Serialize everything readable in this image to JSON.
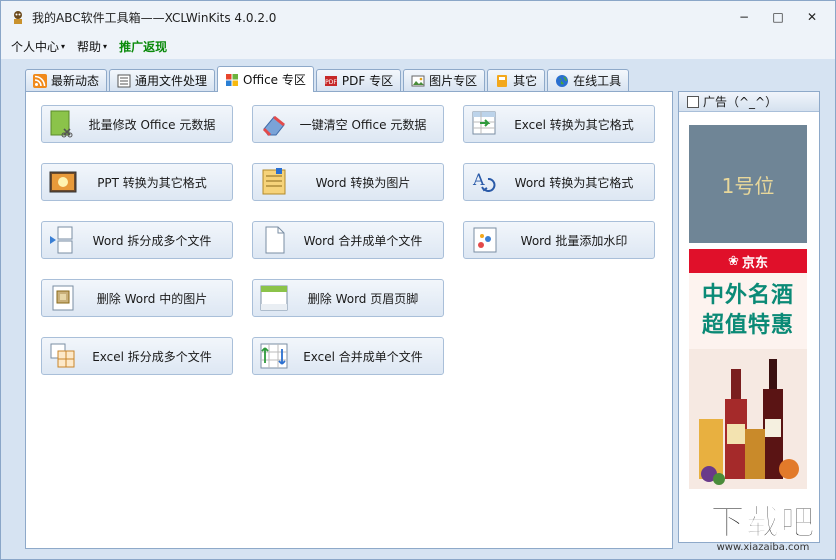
{
  "window": {
    "title": "我的ABC软件工具箱——XCLWinKits  4.0.2.0",
    "minimize": "−",
    "maximize": "□",
    "close": "✕"
  },
  "menu": {
    "items": [
      {
        "label": "个人中心",
        "has_caret": true
      },
      {
        "label": "帮助",
        "has_caret": true
      },
      {
        "label": "推广返现",
        "has_caret": false
      }
    ],
    "caret": "▾"
  },
  "tabs": [
    {
      "label": "最新动态",
      "icon": "rss-icon"
    },
    {
      "label": "通用文件处理",
      "icon": "file-icon"
    },
    {
      "label": "Office 专区",
      "icon": "office-icon",
      "active": true
    },
    {
      "label": "PDF 专区",
      "icon": "pdf-icon"
    },
    {
      "label": "图片专区",
      "icon": "image-icon"
    },
    {
      "label": "其它",
      "icon": "folder-icon"
    },
    {
      "label": "在线工具",
      "icon": "globe-icon"
    }
  ],
  "buttons": [
    {
      "label": "批量修改 Office 元数据",
      "icon": "edit-meta-icon"
    },
    {
      "label": "一键清空 Office 元数据",
      "icon": "eraser-icon"
    },
    {
      "label": "Excel 转换为其它格式",
      "icon": "excel-convert-icon"
    },
    {
      "label": "PPT 转换为其它格式",
      "icon": "ppt-convert-icon"
    },
    {
      "label": "Word 转换为图片",
      "icon": "word-to-image-icon"
    },
    {
      "label": "Word 转换为其它格式",
      "icon": "word-convert-icon"
    },
    {
      "label": "Word 拆分成多个文件",
      "icon": "word-split-icon"
    },
    {
      "label": "Word 合并成单个文件",
      "icon": "word-merge-icon"
    },
    {
      "label": "Word 批量添加水印",
      "icon": "watermark-icon"
    },
    {
      "label": "删除 Word 中的图片",
      "icon": "delete-image-icon"
    },
    {
      "label": "删除 Word 页眉页脚",
      "icon": "header-footer-icon"
    },
    {
      "label": "Excel 拆分成多个文件",
      "icon": "excel-split-icon"
    },
    {
      "label": "Excel 合并成单个文件",
      "icon": "excel-merge-icon"
    }
  ],
  "ad": {
    "header": "广告（^_^）",
    "slot1": "1号位",
    "jd_logo": "京东",
    "jd_line1": "中外名酒",
    "jd_line2": "超值特惠"
  },
  "watermark": {
    "main": "下载吧",
    "sub": "www.xiazaiba.com"
  }
}
